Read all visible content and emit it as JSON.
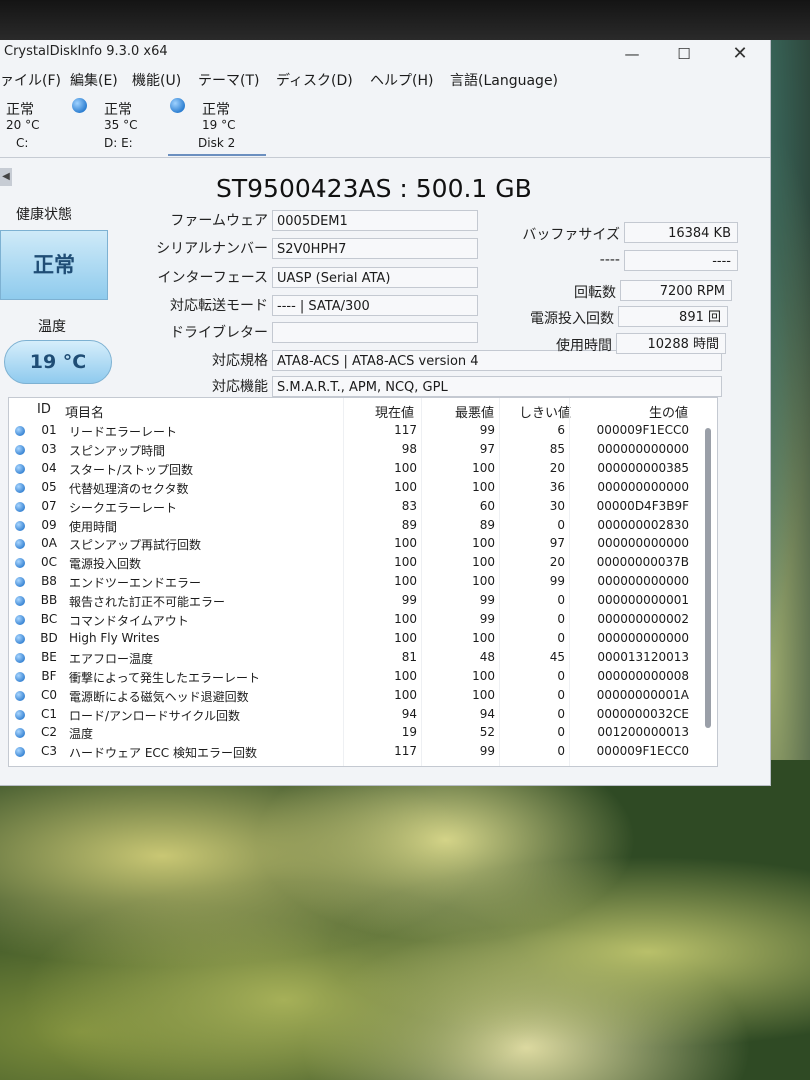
{
  "window": {
    "title": "CrystalDiskInfo 9.3.0 x64",
    "minimize": "—",
    "maximize": "☐",
    "close": "✕"
  },
  "menu": [
    "ァイル(F)",
    "編集(E)",
    "機能(U)",
    "テーマ(T)",
    "ディスク(D)",
    "ヘルプ(H)",
    "言語(Language)"
  ],
  "disks": [
    {
      "status": "正常",
      "temp": "20 °C",
      "drive": "C:"
    },
    {
      "status": "正常",
      "temp": "35 °C",
      "drive": "D: E:"
    },
    {
      "status": "正常",
      "temp": "19 °C",
      "drive": "Disk 2"
    }
  ],
  "model": "ST9500423AS : 500.1 GB",
  "health": {
    "label": "健康状態",
    "status": "正常"
  },
  "temperature": {
    "label": "温度",
    "value": "19 °C"
  },
  "info": {
    "firmware": {
      "label": "ファームウェア",
      "value": "0005DEM1"
    },
    "serial": {
      "label": "シリアルナンバー",
      "value": "S2V0HPH7"
    },
    "interface": {
      "label": "インターフェース",
      "value": "UASP (Serial ATA)"
    },
    "transfer_mode": {
      "label": "対応転送モード",
      "value": "---- | SATA/300"
    },
    "drive_letter": {
      "label": "ドライブレター",
      "value": ""
    },
    "standard": {
      "label": "対応規格",
      "value": "ATA8-ACS | ATA8-ACS version 4"
    },
    "features": {
      "label": "対応機能",
      "value": "S.M.A.R.T., APM, NCQ, GPL"
    },
    "buffer": {
      "label": "バッファサイズ",
      "value": "16384 KB"
    },
    "blank_right": {
      "label": "----",
      "value": "----"
    },
    "rotation": {
      "label": "回転数",
      "value": "7200 RPM"
    },
    "power_on_count": {
      "label": "電源投入回数",
      "value": "891 回"
    },
    "power_on_hours": {
      "label": "使用時間",
      "value": "10288 時間"
    }
  },
  "smart": {
    "headers": {
      "id": "ID",
      "name": "項目名",
      "current": "現在値",
      "worst": "最悪値",
      "threshold": "しきい値",
      "raw": "生の値"
    },
    "rows": [
      {
        "id": "01",
        "name": "リードエラーレート",
        "current": "117",
        "worst": "99",
        "threshold": "6",
        "raw": "000009F1ECC0"
      },
      {
        "id": "03",
        "name": "スピンアップ時間",
        "current": "98",
        "worst": "97",
        "threshold": "85",
        "raw": "000000000000"
      },
      {
        "id": "04",
        "name": "スタート/ストップ回数",
        "current": "100",
        "worst": "100",
        "threshold": "20",
        "raw": "000000000385"
      },
      {
        "id": "05",
        "name": "代替処理済のセクタ数",
        "current": "100",
        "worst": "100",
        "threshold": "36",
        "raw": "000000000000"
      },
      {
        "id": "07",
        "name": "シークエラーレート",
        "current": "83",
        "worst": "60",
        "threshold": "30",
        "raw": "00000D4F3B9F"
      },
      {
        "id": "09",
        "name": "使用時間",
        "current": "89",
        "worst": "89",
        "threshold": "0",
        "raw": "000000002830"
      },
      {
        "id": "0A",
        "name": "スピンアップ再試行回数",
        "current": "100",
        "worst": "100",
        "threshold": "97",
        "raw": "000000000000"
      },
      {
        "id": "0C",
        "name": "電源投入回数",
        "current": "100",
        "worst": "100",
        "threshold": "20",
        "raw": "00000000037B"
      },
      {
        "id": "B8",
        "name": "エンドツーエンドエラー",
        "current": "100",
        "worst": "100",
        "threshold": "99",
        "raw": "000000000000"
      },
      {
        "id": "BB",
        "name": "報告された訂正不可能エラー",
        "current": "99",
        "worst": "99",
        "threshold": "0",
        "raw": "000000000001"
      },
      {
        "id": "BC",
        "name": "コマンドタイムアウト",
        "current": "100",
        "worst": "99",
        "threshold": "0",
        "raw": "000000000002"
      },
      {
        "id": "BD",
        "name": "High Fly Writes",
        "current": "100",
        "worst": "100",
        "threshold": "0",
        "raw": "000000000000"
      },
      {
        "id": "BE",
        "name": "エアフロー温度",
        "current": "81",
        "worst": "48",
        "threshold": "45",
        "raw": "000013120013"
      },
      {
        "id": "BF",
        "name": "衝撃によって発生したエラーレート",
        "current": "100",
        "worst": "100",
        "threshold": "0",
        "raw": "000000000008"
      },
      {
        "id": "C0",
        "name": "電源断による磁気ヘッド退避回数",
        "current": "100",
        "worst": "100",
        "threshold": "0",
        "raw": "00000000001A"
      },
      {
        "id": "C1",
        "name": "ロード/アンロードサイクル回数",
        "current": "94",
        "worst": "94",
        "threshold": "0",
        "raw": "0000000032CE"
      },
      {
        "id": "C2",
        "name": "温度",
        "current": "19",
        "worst": "52",
        "threshold": "0",
        "raw": "001200000013"
      },
      {
        "id": "C3",
        "name": "ハードウェア ECC 検知エラー回数",
        "current": "117",
        "worst": "99",
        "threshold": "0",
        "raw": "000009F1ECC0"
      }
    ]
  }
}
